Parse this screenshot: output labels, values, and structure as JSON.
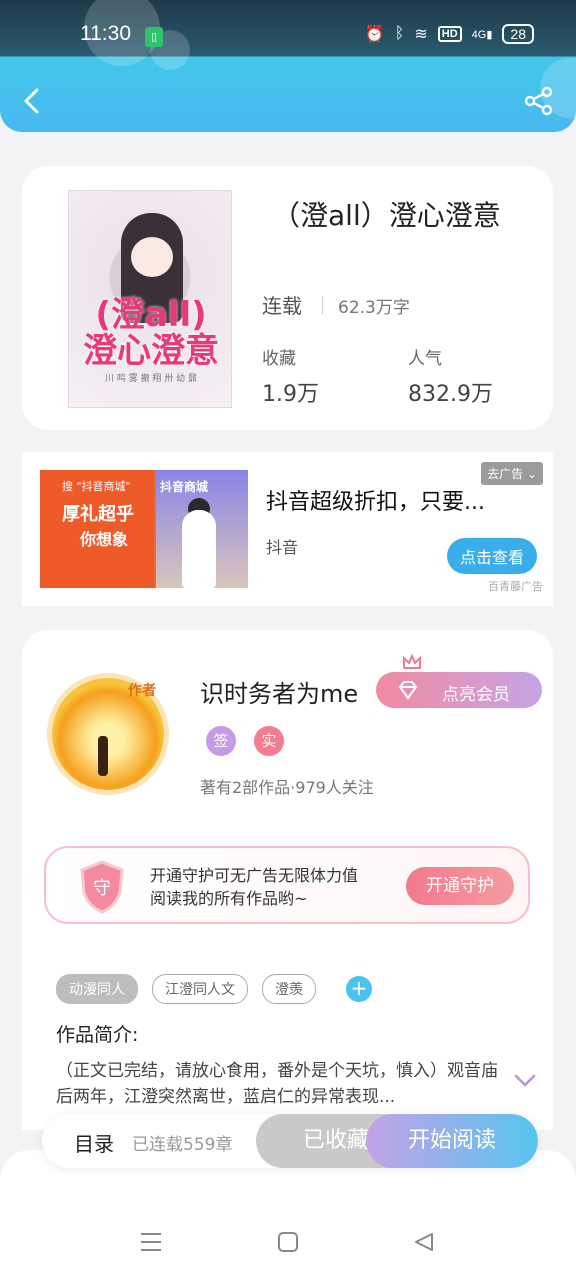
{
  "status_bar": {
    "time": "11:30",
    "hd": "HD",
    "network": "4G",
    "battery": "28"
  },
  "book": {
    "title": "（澄all）澄心澄意",
    "cover_title": "(澄all)\n澄心澄意",
    "cover_small": "川 鸣 雾 撤 翔 卅 幼 鼐",
    "status": "连载",
    "words": "62.3万字",
    "favorites_label": "收藏",
    "favorites_value": "1.9万",
    "popularity_label": "人气",
    "popularity_value": "832.9万"
  },
  "ad": {
    "remove_label": "去广告 ⌄",
    "headline": "抖音超级折扣，只要...",
    "brand": "抖音",
    "cta": "点击查看",
    "source": "百青藤广告",
    "image_text_1": "厚礼超乎",
    "image_text_2": "你想象",
    "image_text_3": "搜 \"抖音商城\"",
    "image_text_4": "抖音商城"
  },
  "author": {
    "avatar_tag": "作者",
    "name": "识时务者为me",
    "vip_button": "点亮会员",
    "badge_sign": "签",
    "badge_real": "实",
    "stats": "著有2部作品·979人关注",
    "guard_icon_text": "守",
    "guard_line1": "开通守护可无广告无限体力值",
    "guard_line2": "阅读我的所有作品哟~",
    "guard_button": "开通守护"
  },
  "tags": [
    "动漫同人",
    "江澄同人文",
    "澄羡"
  ],
  "intro": {
    "heading": "作品简介:",
    "text": "（正文已完结，请放心食用，番外是个天坑，慎入）观音庙后两年，江澄突然离世，蓝启仁的异常表现..."
  },
  "bottom_bar": {
    "toc": "目录",
    "chapters": "已连载559章",
    "favorited": "已收藏",
    "start_reading": "开始阅读"
  },
  "colors": {
    "accent": "#49b8f0",
    "pink": "#f2798d",
    "purple": "#c3a2e6"
  }
}
